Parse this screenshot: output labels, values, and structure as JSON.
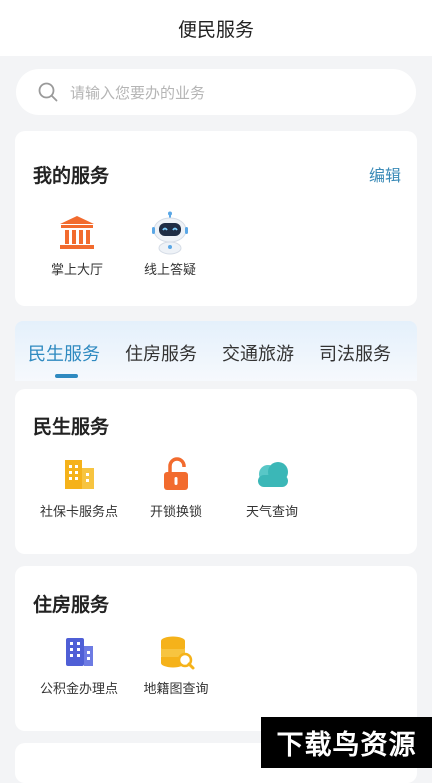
{
  "header": {
    "title": "便民服务"
  },
  "search": {
    "placeholder": "请输入您要办的业务"
  },
  "my_services": {
    "title": "我的服务",
    "edit_label": "编辑",
    "items": [
      {
        "label": "掌上大厅",
        "icon": "government-building-icon"
      },
      {
        "label": "线上答疑",
        "icon": "robot-icon"
      }
    ]
  },
  "tabs": [
    {
      "label": "民生服务",
      "active": true
    },
    {
      "label": "住房服务",
      "active": false
    },
    {
      "label": "交通旅游",
      "active": false
    },
    {
      "label": "司法服务",
      "active": false
    }
  ],
  "minsheng": {
    "title": "民生服务",
    "items": [
      {
        "label": "社保卡服务点",
        "icon": "building-icon"
      },
      {
        "label": "开锁换锁",
        "icon": "unlock-icon"
      },
      {
        "label": "天气查询",
        "icon": "cloud-icon"
      }
    ]
  },
  "zhufang": {
    "title": "住房服务",
    "items": [
      {
        "label": "公积金办理点",
        "icon": "office-building-icon"
      },
      {
        "label": "地籍图查询",
        "icon": "database-search-icon"
      }
    ]
  },
  "watermark": {
    "text": "下载鸟资源"
  },
  "colors": {
    "accent": "#2f8ac0",
    "orange": "#f26b2e",
    "amber": "#f5b21a",
    "teal": "#3bb7b7",
    "indigo": "#4f5fd6"
  }
}
